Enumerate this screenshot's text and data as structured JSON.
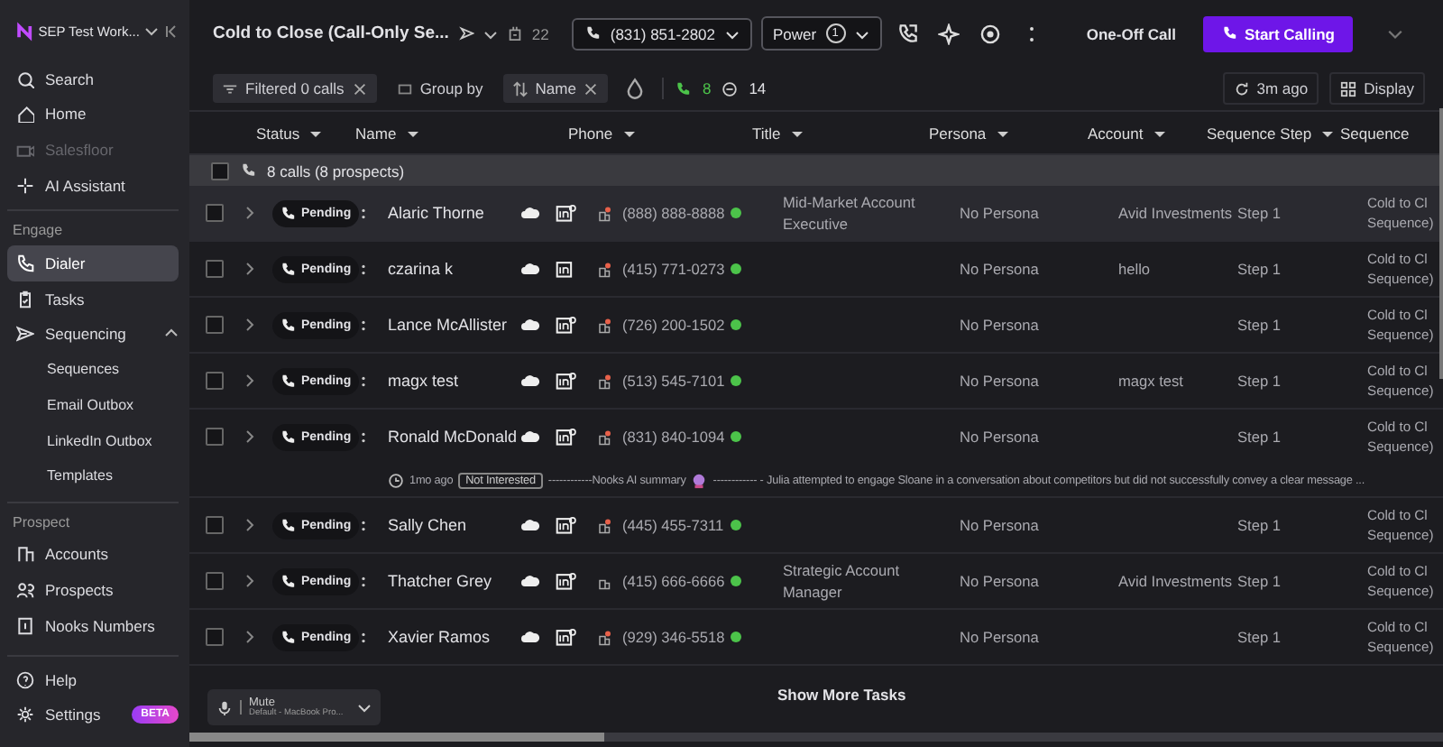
{
  "sidebar": {
    "workspace": "SEP Test Work...",
    "top_items": [
      {
        "label": "Search",
        "selected": false,
        "disabled": false
      },
      {
        "label": "Home",
        "selected": false,
        "disabled": false
      },
      {
        "label": "Salesfloor",
        "selected": false,
        "disabled": true
      },
      {
        "label": "AI Assistant",
        "selected": false,
        "disabled": false
      }
    ],
    "sections": [
      {
        "title": "Engage",
        "items": [
          {
            "label": "Dialer",
            "selected": true
          },
          {
            "label": "Tasks",
            "selected": false
          },
          {
            "label": "Sequencing",
            "selected": false,
            "expanded": true,
            "children": [
              {
                "label": "Sequences",
                "selected": false
              },
              {
                "label": "Email Outbox",
                "selected": false
              },
              {
                "label": "LinkedIn Outbox",
                "selected": false
              },
              {
                "label": "Templates",
                "selected": false
              }
            ]
          }
        ]
      },
      {
        "title": "Prospect",
        "items": [
          {
            "label": "Accounts",
            "selected": false
          },
          {
            "label": "Prospects",
            "selected": false
          },
          {
            "label": "Nooks Numbers",
            "selected": false
          }
        ]
      }
    ],
    "bottom_items": [
      {
        "label": "Help",
        "selected": false
      },
      {
        "label": "Settings",
        "selected": false,
        "badge": "BETA"
      }
    ]
  },
  "header": {
    "title": "Cold to Close (Call-Only Se...",
    "task_count": "22",
    "caller_number": "(831) 851-2802",
    "mode": "Power",
    "mode_count": "1",
    "one_off": "One-Off Call",
    "start": "Start Calling"
  },
  "filters": {
    "filtered": "Filtered 0 calls",
    "group_by": "Group by",
    "sort": "Name",
    "calls": "8",
    "other_count": "14",
    "refreshed": "3m ago",
    "display": "Display"
  },
  "table": {
    "columns": [
      "Status",
      "Name",
      "Phone",
      "Title",
      "Persona",
      "Account",
      "Sequence Step",
      "Sequence"
    ],
    "group": "8 calls (8 prospects)",
    "group_checked": false,
    "rows": [
      {
        "status": "Pending",
        "name": "Alaric Thorne",
        "phone": "(888) 888-8888",
        "title": "Mid-Market Account Executive",
        "persona": "No Persona",
        "account": "Avid Investments",
        "step": "Step 1",
        "sequence": [
          "Cold to Cl",
          "Sequence)"
        ],
        "highlighted": true,
        "checked": false,
        "linkedin_search": true,
        "phone_flag": true
      },
      {
        "status": "Pending",
        "name": "czarina k",
        "phone": "(415) 771-0273",
        "persona": "No Persona",
        "account": "hello",
        "step": "Step 1",
        "sequence": [
          "Cold to Cl",
          "Sequence)"
        ],
        "highlighted": false,
        "checked": false,
        "linkedin_search": false,
        "phone_flag": true
      },
      {
        "status": "Pending",
        "name": "Lance McAllister",
        "phone": "(726) 200-1502",
        "persona": "No Persona",
        "step": "Step 1",
        "sequence": [
          "Cold to Cl",
          "Sequence)"
        ],
        "highlighted": false,
        "checked": false,
        "linkedin_search": true,
        "phone_flag": true
      },
      {
        "status": "Pending",
        "name": "magx test",
        "phone": "(513) 545-7101",
        "persona": "No Persona",
        "account": "magx test",
        "step": "Step 1",
        "sequence": [
          "Cold to Cl",
          "Sequence)"
        ],
        "highlighted": false,
        "checked": false,
        "linkedin_search": true,
        "phone_flag": true
      },
      {
        "status": "Pending",
        "name": "Ronald McDonald",
        "phone": "(831) 840-1094",
        "persona": "No Persona",
        "step": "Step 1",
        "sequence": [
          "Cold to Cl",
          "Sequence)"
        ],
        "highlighted": false,
        "checked": false,
        "linkedin_search": true,
        "phone_flag": true,
        "summary": {
          "time": "1mo ago",
          "disposition": "Not Interested",
          "lead": "------------Nooks AI summary",
          "text": "------------ - Julia attempted to engage Sloane in a conversation about competitors but did not successfully convey a clear message ..."
        }
      },
      {
        "status": "Pending",
        "name": "Sally Chen",
        "phone": "(445) 455-7311",
        "persona": "No Persona",
        "step": "Step 1",
        "sequence": [
          "Cold to Cl",
          "Sequence)"
        ],
        "highlighted": false,
        "checked": false,
        "linkedin_search": true,
        "phone_flag": true
      },
      {
        "status": "Pending",
        "name": "Thatcher Grey",
        "phone": "(415) 666-6666",
        "title": "Strategic Account Manager",
        "persona": "No Persona",
        "account": "Avid Investments",
        "step": "Step 1",
        "sequence": [
          "Cold to Cl",
          "Sequence)"
        ],
        "highlighted": false,
        "checked": false,
        "linkedin_search": true,
        "phone_flag": false
      },
      {
        "status": "Pending",
        "name": "Xavier Ramos",
        "phone": "(929) 346-5518",
        "persona": "No Persona",
        "step": "Step 1",
        "sequence": [
          "Cold to Cl",
          "Sequence)"
        ],
        "highlighted": false,
        "checked": false,
        "linkedin_search": true,
        "phone_flag": true
      }
    ],
    "show_more": "Show More Tasks"
  },
  "mute": {
    "label": "Mute",
    "device": "Default - MacBook Pro..."
  }
}
